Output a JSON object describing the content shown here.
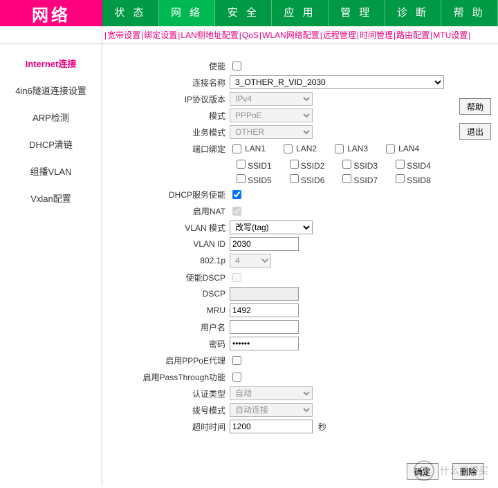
{
  "brand": "网络",
  "tabs": [
    "状 态",
    "网 络",
    "安 全",
    "应 用",
    "管 理",
    "诊 断",
    "帮 助"
  ],
  "active_tab_index": 1,
  "subnav": [
    "宽带设置",
    "绑定设置",
    "LAN侧地址配置",
    "QoS",
    "WLAN网络配置",
    "远程管理",
    "时间管理",
    "路由配置",
    "MTU设置"
  ],
  "leftnav": {
    "items": [
      "Internet连接",
      "4in6隧道连接设置",
      "ARP检测",
      "DHCP清链",
      "组播VLAN",
      "Vxlan配置"
    ],
    "active_index": 0
  },
  "sidebuttons": {
    "help": "帮助",
    "exit": "退出"
  },
  "bottombuttons": {
    "ok": "确定",
    "del": "删除"
  },
  "form": {
    "enable_label": "使能",
    "enable": false,
    "connname_label": "连接名称",
    "connname": "3_OTHER_R_VID_2030",
    "ipver_label": "IP协议版本",
    "ipver": "IPv4",
    "mode_label": "模式",
    "mode": "PPPoE",
    "svcmode_label": "业务模式",
    "svcmode": "OTHER",
    "portbind_label": "端口绑定",
    "lan_ports": [
      "LAN1",
      "LAN2",
      "LAN3",
      "LAN4"
    ],
    "ssid_a": [
      "SSID1",
      "SSID2",
      "SSID3",
      "SSID4"
    ],
    "ssid_b": [
      "SSID5",
      "SSID6",
      "SSID7",
      "SSID8"
    ],
    "dhcpsrv_enable_label": "DHCP服务使能",
    "dhcpsrv_enable": true,
    "nat_label": "启用NAT",
    "nat": true,
    "vlanmode_label": "VLAN 模式",
    "vlanmode": "改写(tag)",
    "vlanid_label": "VLAN ID",
    "vlanid": "2030",
    "dot1p_label": "802.1p",
    "dot1p": "4",
    "dscp_enable_label": "使能DSCP",
    "dscp_enable": false,
    "dscp_label": "DSCP",
    "dscp": "",
    "mru_label": "MRU",
    "mru": "1492",
    "user_label": "用户名",
    "user": "",
    "pass_label": "密码",
    "pass": "••••••",
    "pppoeproxy_label": "启用PPPoE代理",
    "pppoeproxy": false,
    "passthrough_label": "启用PassThrough功能",
    "passthrough": false,
    "authtype_label": "认证类型",
    "authtype": "自动",
    "dialmode_label": "拨号模式",
    "dialmode": "自动连接",
    "timeout_label": "超时时间",
    "timeout": "1200",
    "timeout_suffix": "秒"
  },
  "watermark": {
    "glyph": "值",
    "text": "什么值得买"
  }
}
